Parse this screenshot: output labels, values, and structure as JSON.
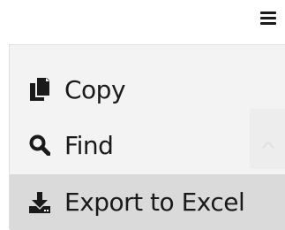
{
  "header": {
    "menu_icon": "hamburger-icon"
  },
  "menu": {
    "items": [
      {
        "label": "Copy",
        "icon": "copy-icon"
      },
      {
        "label": "Find",
        "icon": "search-icon"
      },
      {
        "label": "Export to Excel",
        "icon": "download-icon"
      }
    ],
    "highlighted_item": "Export to Excel"
  },
  "colors": {
    "menu_background": "#f3f3f3",
    "highlight_background": "#dadada",
    "text": "#1a1a1a"
  }
}
